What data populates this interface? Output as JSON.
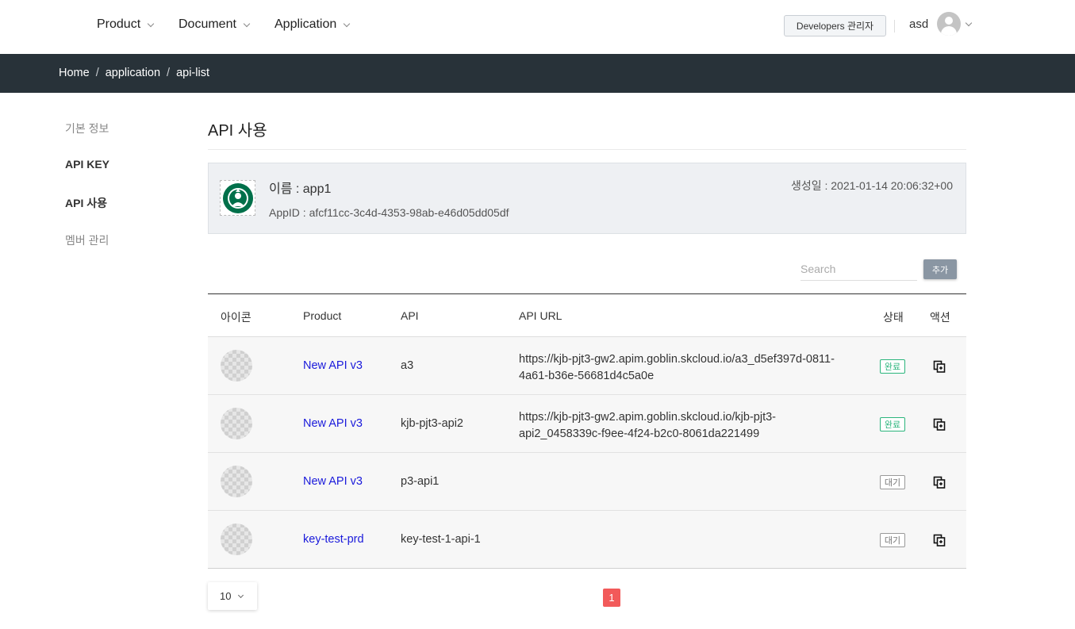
{
  "nav": {
    "items": [
      {
        "label": "Product"
      },
      {
        "label": "Document"
      },
      {
        "label": "Application"
      }
    ],
    "dev_button": "Developers 관리자",
    "username": "asd"
  },
  "breadcrumb": [
    "Home",
    "application",
    "api-list"
  ],
  "sidebar": {
    "items": [
      {
        "label": "기본 정보",
        "active": false
      },
      {
        "label": "API KEY",
        "active": true
      },
      {
        "label": "API 사용",
        "active": true
      },
      {
        "label": "멤버 관리",
        "active": false
      }
    ]
  },
  "page": {
    "title": "API 사용"
  },
  "app": {
    "name": "이름 : app1",
    "app_id": "AppID : afcf11cc-3c4d-4353-98ab-e46d05dd05df",
    "created": "생성일 : 2021-01-14 20:06:32+00"
  },
  "search": {
    "placeholder": "Search",
    "add_label": "추가"
  },
  "table": {
    "headers": [
      "아이콘",
      "Product",
      "API",
      "API URL",
      "상태",
      "액션"
    ],
    "rows": [
      {
        "product": "New API v3",
        "api": "a3",
        "url_line1": "https://kjb-pjt3-gw2.apim.goblin.skcloud.io/a3_d5ef397d-0811-",
        "url_line2": "4a61-b36e-56681d4c5a0e",
        "status": "완료",
        "status_type": "done"
      },
      {
        "product": "New API v3",
        "api": "kjb-pjt3-api2",
        "url_line1": "https://kjb-pjt3-gw2.apim.goblin.skcloud.io/kjb-pjt3-",
        "url_line2": "api2_0458339c-f9ee-4f24-b2c0-8061da221499",
        "status": "완료",
        "status_type": "done"
      },
      {
        "product": "New API v3",
        "api": "p3-api1",
        "url_line1": "",
        "url_line2": "",
        "status": "대기",
        "status_type": "wait"
      },
      {
        "product": "key-test-prd",
        "api": "key-test-1-api-1",
        "url_line1": "",
        "url_line2": "",
        "status": "대기",
        "status_type": "wait"
      }
    ]
  },
  "pagination": {
    "page_size": "10",
    "current_page": "1"
  },
  "colors": {
    "breadcrumb_bg": "#283239",
    "link": "#1a1adb",
    "status_done": "#2bb57c",
    "current_page": "#f25a5a"
  }
}
